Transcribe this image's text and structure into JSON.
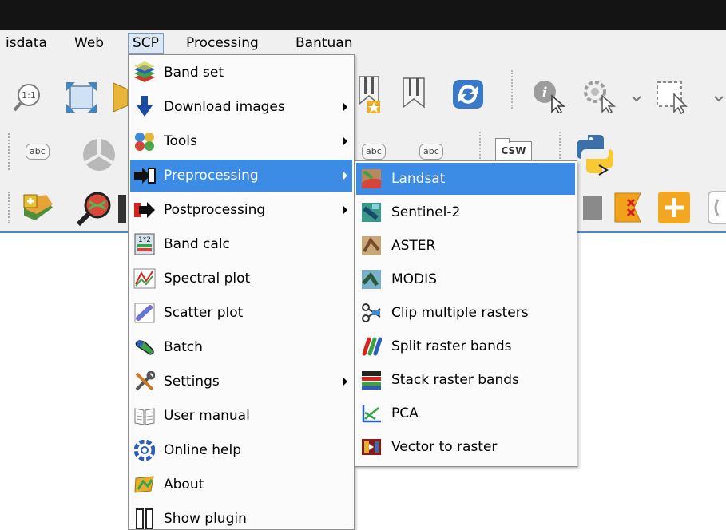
{
  "menubar": {
    "items": [
      {
        "label": "isdata",
        "icon": null
      },
      {
        "label": "Web"
      },
      {
        "label": "SCP"
      },
      {
        "label": "Processing"
      },
      {
        "label": "Bantuan"
      }
    ]
  },
  "scp_menu": {
    "items": [
      {
        "label": "Band set",
        "icon": "band-set-icon",
        "submenu": false
      },
      {
        "label": "Download images",
        "icon": "download-arrow-icon",
        "submenu": true
      },
      {
        "label": "Tools",
        "icon": "tools-icon",
        "submenu": true
      },
      {
        "label": "Preprocessing",
        "icon": "preprocessing-icon",
        "submenu": true,
        "highlighted": true
      },
      {
        "label": "Postprocessing",
        "icon": "postprocessing-icon",
        "submenu": true
      },
      {
        "label": "Band calc",
        "icon": "band-calc-icon",
        "submenu": false
      },
      {
        "label": "Spectral plot",
        "icon": "spectral-plot-icon",
        "submenu": false
      },
      {
        "label": "Scatter plot",
        "icon": "scatter-plot-icon",
        "submenu": false
      },
      {
        "label": "Batch",
        "icon": "batch-icon",
        "submenu": false
      },
      {
        "label": "Settings",
        "icon": "settings-tools-icon",
        "submenu": true
      },
      {
        "label": "User manual",
        "icon": "user-manual-icon",
        "submenu": false
      },
      {
        "label": "Online help",
        "icon": "online-help-icon",
        "submenu": false
      },
      {
        "label": "About",
        "icon": "about-icon",
        "submenu": false
      },
      {
        "label": "Show plugin",
        "icon": "show-plugin-icon",
        "submenu": false
      }
    ]
  },
  "preprocessing_submenu": {
    "items": [
      {
        "label": "Landsat",
        "icon": "landsat-icon",
        "highlighted": true
      },
      {
        "label": "Sentinel-2",
        "icon": "sentinel-2-icon"
      },
      {
        "label": "ASTER",
        "icon": "aster-icon"
      },
      {
        "label": "MODIS",
        "icon": "modis-icon"
      },
      {
        "label": "Clip multiple rasters",
        "icon": "clip-rasters-icon"
      },
      {
        "label": "Split raster bands",
        "icon": "split-bands-icon"
      },
      {
        "label": "Stack raster bands",
        "icon": "stack-bands-icon"
      },
      {
        "label": "PCA",
        "icon": "pca-icon"
      },
      {
        "label": "Vector to raster",
        "icon": "vector-to-raster-icon"
      }
    ]
  },
  "toolbar": {
    "abc_label": "abc",
    "csw_label": "CSW",
    "zoom_native_label": "1:1"
  },
  "colors": {
    "highlight": "#3c8ce6",
    "menubar_bg": "#f0f0f0",
    "titlebar_bg": "#141414"
  }
}
